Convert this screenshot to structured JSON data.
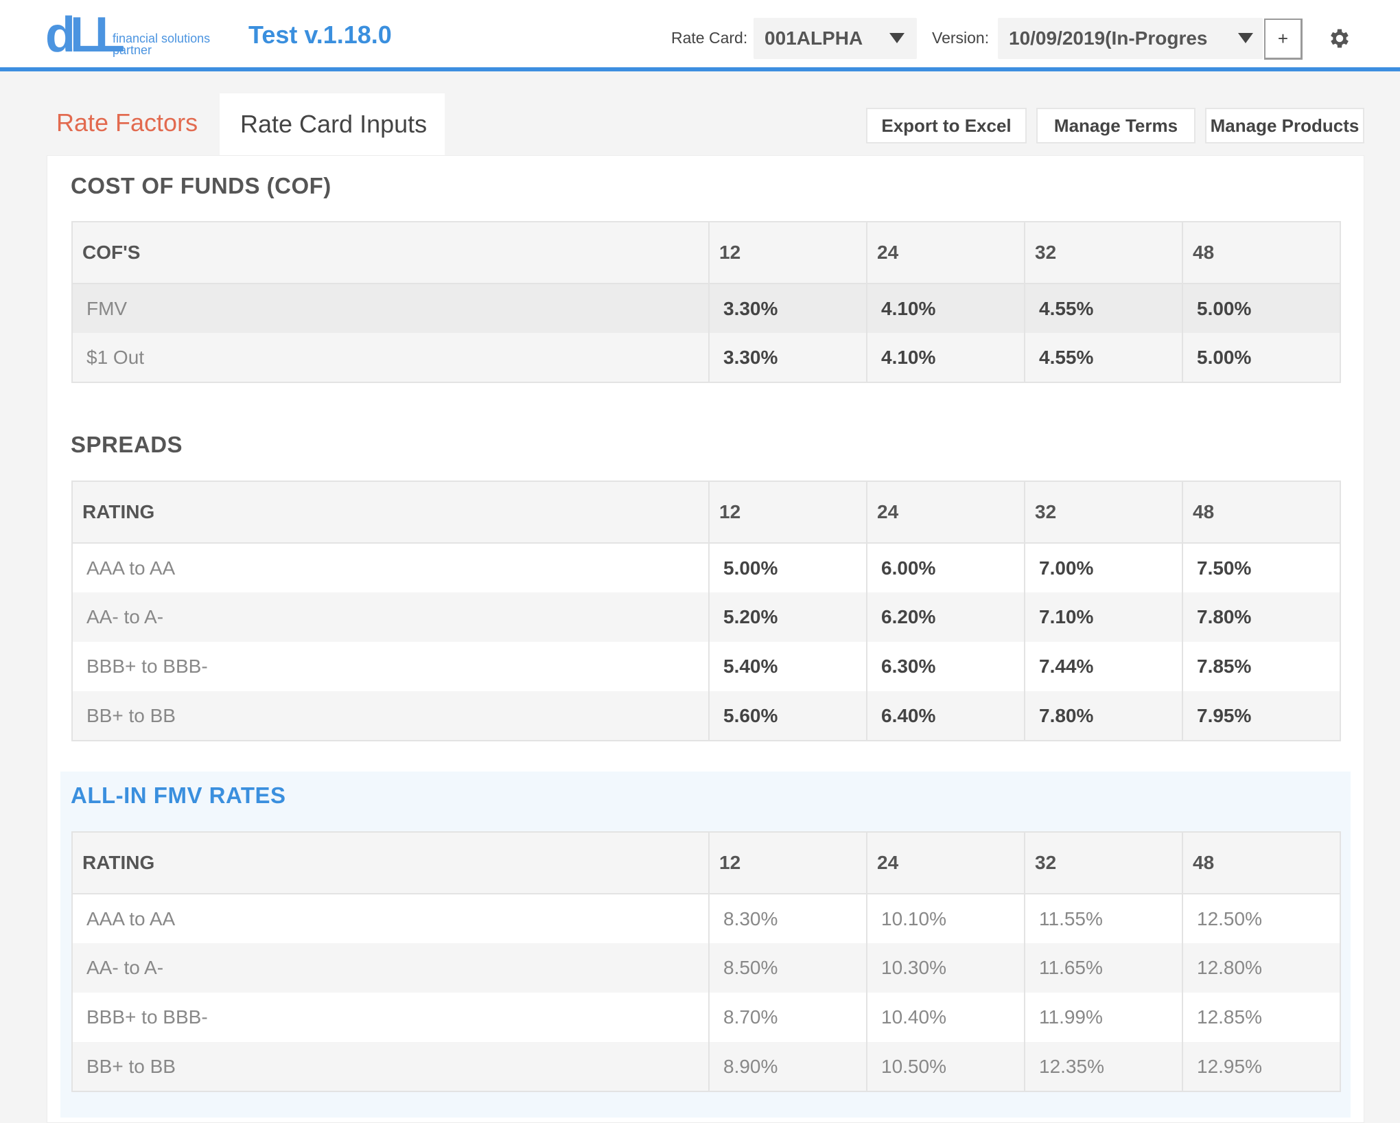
{
  "header": {
    "logo_text_line1": "financial solutions",
    "logo_text_line2": "partner",
    "app_title": "Test v.1.18.0",
    "rate_card_label": "Rate Card:",
    "rate_card_value": "001ALPHA",
    "version_label": "Version:",
    "version_value": "10/09/2019(In-Progres",
    "plus_label": "+",
    "settings_icon": "gear-icon"
  },
  "tabs": [
    {
      "label": "Rate Factors",
      "active": true
    },
    {
      "label": "Rate Card Inputs",
      "active": false
    }
  ],
  "toolbar": {
    "export_label": "Export to Excel",
    "manage_terms_label": "Manage Terms",
    "manage_products_label": "Manage Products"
  },
  "colors": {
    "accent_blue": "#3a8fde",
    "active_tab": "#e26a4f"
  },
  "cof": {
    "title": "COST OF FUNDS (COF)",
    "header": [
      "COF'S",
      "12",
      "24",
      "32",
      "48"
    ],
    "rows": [
      {
        "label": "FMV",
        "values": [
          "3.30%",
          "4.10%",
          "4.55%",
          "5.00%"
        ]
      },
      {
        "label": "$1 Out",
        "values": [
          "3.30%",
          "4.10%",
          "4.55%",
          "5.00%"
        ]
      }
    ]
  },
  "spreads": {
    "title": "SPREADS",
    "header": [
      "RATING",
      "12",
      "24",
      "32",
      "48"
    ],
    "rows": [
      {
        "label": "AAA to AA",
        "values": [
          "5.00%",
          "6.00%",
          "7.00%",
          "7.50%"
        ]
      },
      {
        "label": "AA- to A-",
        "values": [
          "5.20%",
          "6.20%",
          "7.10%",
          "7.80%"
        ]
      },
      {
        "label": "BBB+ to BBB-",
        "values": [
          "5.40%",
          "6.30%",
          "7.44%",
          "7.85%"
        ]
      },
      {
        "label": "BB+ to BB",
        "values": [
          "5.60%",
          "6.40%",
          "7.80%",
          "7.95%"
        ]
      }
    ]
  },
  "allin": {
    "title": "ALL-IN FMV RATES",
    "header": [
      "RATING",
      "12",
      "24",
      "32",
      "48"
    ],
    "rows": [
      {
        "label": "AAA to AA",
        "values": [
          "8.30%",
          "10.10%",
          "11.55%",
          "12.50%"
        ]
      },
      {
        "label": "AA- to A-",
        "values": [
          "8.50%",
          "10.30%",
          "11.65%",
          "12.80%"
        ]
      },
      {
        "label": "BBB+ to BBB-",
        "values": [
          "8.70%",
          "10.40%",
          "11.99%",
          "12.85%"
        ]
      },
      {
        "label": "BB+ to BB",
        "values": [
          "8.90%",
          "10.50%",
          "12.35%",
          "12.95%"
        ]
      }
    ]
  }
}
